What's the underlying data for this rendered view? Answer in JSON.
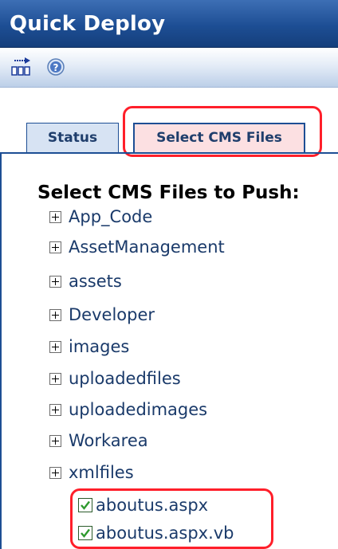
{
  "window": {
    "title": "Quick Deploy"
  },
  "toolbar": {
    "deploy_icon": "deploy-icon",
    "help_icon": "help-icon"
  },
  "tabs": [
    {
      "label": "Status",
      "selected": false
    },
    {
      "label": "Select CMS Files",
      "selected": true
    }
  ],
  "panel": {
    "heading": "Select CMS Files to Push:",
    "folders": [
      {
        "label": "App_Code",
        "expanded": false
      },
      {
        "label": "AssetManagement",
        "expanded": false
      },
      {
        "label": "assets",
        "expanded": false
      },
      {
        "label": "Developer",
        "expanded": false
      },
      {
        "label": "images",
        "expanded": false
      },
      {
        "label": "uploadedfiles",
        "expanded": false
      },
      {
        "label": "uploadedimages",
        "expanded": false
      },
      {
        "label": "Workarea",
        "expanded": false
      },
      {
        "label": "xmlfiles",
        "expanded": false
      }
    ],
    "files": [
      {
        "label": "aboutus.aspx",
        "checked": true
      },
      {
        "label": "aboutus.aspx.vb",
        "checked": true
      }
    ]
  },
  "colors": {
    "title_bar": "#1d4e94",
    "highlight": "#ff1f2a",
    "tab_selected_bg": "#fce0e2",
    "tab_bg": "#d7e3f3",
    "link_text": "#1a3a6a",
    "check": "#2e9a2e"
  }
}
